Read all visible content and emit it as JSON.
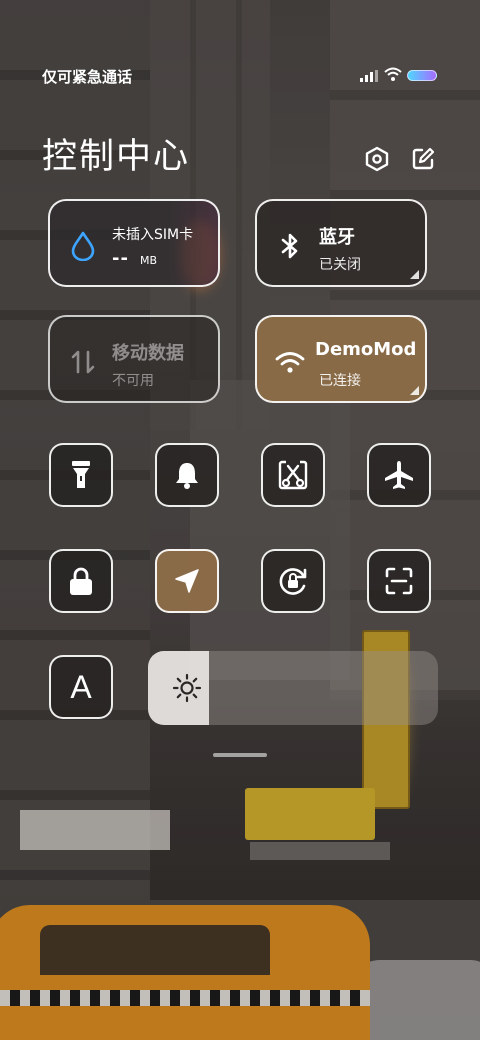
{
  "status_bar": {
    "carrier": "仅可紧急通话",
    "battery_gradient": [
      "#4fd6ff",
      "#a56bff"
    ]
  },
  "header": {
    "title": "控制中心",
    "settings_icon": "hexagon-settings-icon",
    "edit_icon": "edit-icon"
  },
  "tiles": {
    "sim": {
      "line1": "未插入SIM卡",
      "value": "--",
      "unit": "MB",
      "icon": "water-drop-icon",
      "icon_color": "#3da4ff"
    },
    "bluetooth": {
      "label": "蓝牙",
      "status": "已关闭",
      "icon": "bluetooth-icon"
    },
    "mobile_data": {
      "label": "移动数据",
      "status": "不可用",
      "icon": "data-arrows-icon"
    },
    "wifi": {
      "label": "DemoMod",
      "status": "已连接",
      "icon": "wifi-icon",
      "active_color": "#8e6e48"
    }
  },
  "toggles": {
    "row1": [
      "flashlight-icon",
      "bell-icon",
      "screenshot-scissors-icon",
      "airplane-icon"
    ],
    "row2": [
      "lock-icon",
      "location-icon",
      "rotation-lock-icon",
      "scanner-icon"
    ],
    "font_letter": "A"
  },
  "brightness": {
    "level_percent": 21,
    "icon": "sun-icon"
  }
}
